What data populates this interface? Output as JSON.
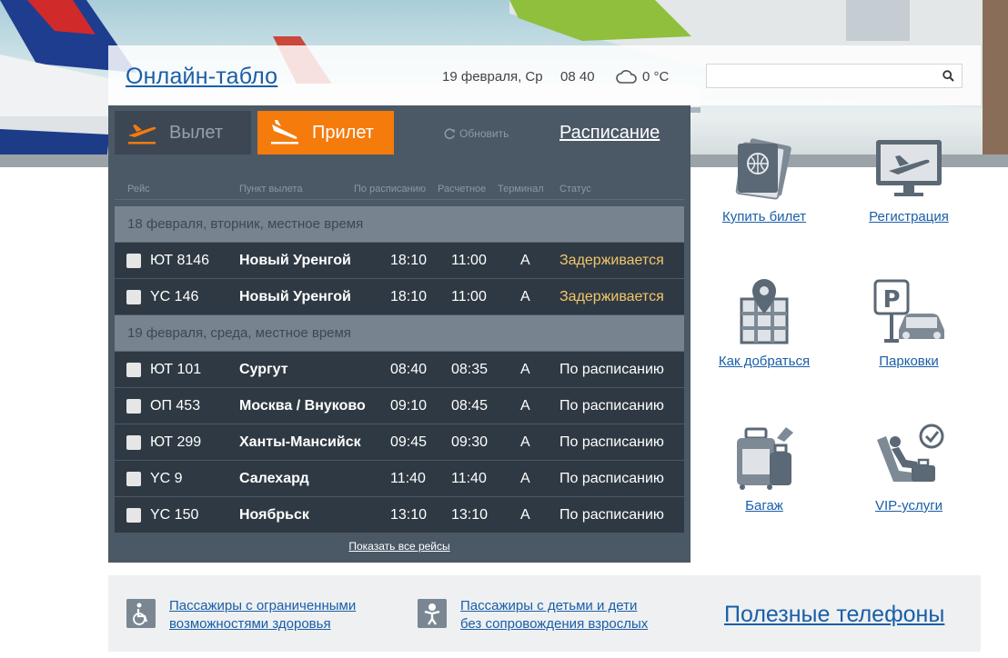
{
  "header": {
    "title": "Онлайн-табло",
    "date": "19 февраля, Ср",
    "time": "08 40",
    "weather_icon": "cloud-icon",
    "temperature": "0 °C",
    "search_placeholder": ""
  },
  "board": {
    "tabs": {
      "departure": "Вылет",
      "arrival": "Прилет"
    },
    "refresh_label": "Обновить",
    "schedule_link": "Расписание",
    "columns": [
      "Рейс",
      "Пункт вылета",
      "По расписанию",
      "Расчетное",
      "Терминал",
      "Статус"
    ],
    "days": [
      {
        "label": "18 февраля, вторник, местное время",
        "flights": [
          {
            "number": "ЮТ 8146",
            "city": "Новый Уренгой",
            "scheduled": "18:10",
            "estimated": "11:00",
            "terminal": "A",
            "status": "Задерживается",
            "delayed": true
          },
          {
            "number": "YC 146",
            "city": "Новый Уренгой",
            "scheduled": "18:10",
            "estimated": "11:00",
            "terminal": "A",
            "status": "Задерживается",
            "delayed": true
          }
        ]
      },
      {
        "label": "19 февраля, среда, местное время",
        "flights": [
          {
            "number": "ЮТ 101",
            "city": "Сургут",
            "scheduled": "08:40",
            "estimated": "08:35",
            "terminal": "A",
            "status": "По расписанию",
            "delayed": false
          },
          {
            "number": "ОП 453",
            "city": "Москва / Внуково",
            "scheduled": "09:10",
            "estimated": "08:45",
            "terminal": "A",
            "status": "По расписанию",
            "delayed": false
          },
          {
            "number": "ЮТ 299",
            "city": "Ханты-Мансийск",
            "scheduled": "09:45",
            "estimated": "09:30",
            "terminal": "A",
            "status": "По расписанию",
            "delayed": false
          },
          {
            "number": "YC 9",
            "city": "Салехард",
            "scheduled": "11:40",
            "estimated": "11:40",
            "terminal": "A",
            "status": "По расписанию",
            "delayed": false
          },
          {
            "number": "YC 150",
            "city": "Ноябрьск",
            "scheduled": "13:10",
            "estimated": "13:10",
            "terminal": "A",
            "status": "По расписанию",
            "delayed": false
          }
        ]
      }
    ],
    "show_all": "Показать все рейсы"
  },
  "services": {
    "buy_ticket": "Купить билет",
    "checkin": "Регистрация",
    "directions": "Как добраться",
    "parking": "Парковки",
    "baggage": "Багаж",
    "vip": "VIP-услуги"
  },
  "bottom": {
    "disabled_line1": "Пассажиры с ограниченными",
    "disabled_line2": "возможностями здоровья",
    "children_line1": "Пассажиры с детьми и дети",
    "children_line2": "без сопровождения взрослых",
    "phones": "Полезные телефоны"
  },
  "colors": {
    "accent_orange": "#f47b0c",
    "link_blue": "#1a5ea8",
    "board_bg": "#4b5866",
    "delayed": "#f2c66a"
  }
}
